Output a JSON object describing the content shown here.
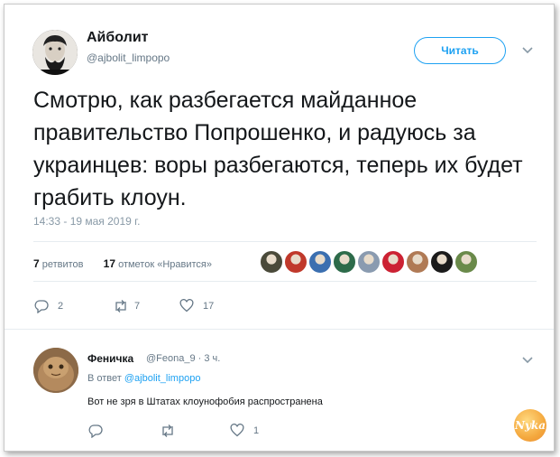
{
  "tweet": {
    "author_name": "Айболит",
    "author_handle": "@ajbolit_limpopo",
    "follow_label": "Читать",
    "text": "Смотрю, как разбегается майданное правительство Попрошенко, и радуюсь за украинцев: воры разбегаются, теперь их будет грабить клоун.",
    "timestamp": "14:33 - 19 мая 2019 г.",
    "retweets_count": "7",
    "retweets_label": "ретвитов",
    "likes_count": "17",
    "likes_label": "отметок «Нравится»",
    "liker_colors": [
      "#4a4a3a",
      "#c0392b",
      "#3b6fb0",
      "#2d6b4a",
      "#8a9bb0",
      "#cc2233",
      "#b07a55",
      "#1b1b1b",
      "#6a8a4a"
    ]
  },
  "actions": {
    "reply_count": "2",
    "retweet_count": "7",
    "like_count": "17"
  },
  "reply": {
    "author_name": "Феничка",
    "author_handle": "@Feona_9 · 3 ч.",
    "reply_to_prefix": "В ответ",
    "reply_to_handle": "@ajbolit_limpopo",
    "text": "Вот не зря в Штатах клоунофобия распространена",
    "like_count": "1"
  },
  "watermark": {
    "text": "Nyka"
  },
  "colors": {
    "accent": "#1da1f2",
    "muted": "#657786",
    "text": "#14171a"
  }
}
